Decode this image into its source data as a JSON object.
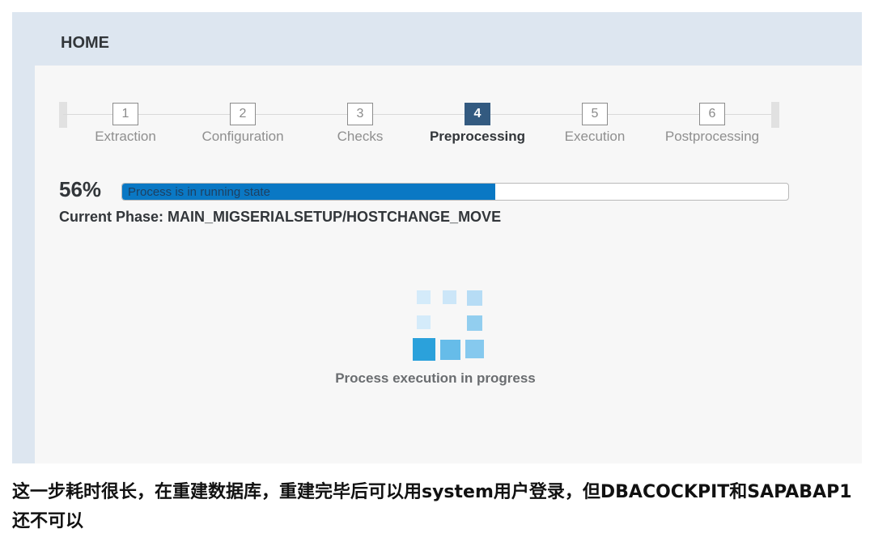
{
  "header": {
    "title": "HOME"
  },
  "wizard": {
    "steps": [
      {
        "number": "1",
        "label": "Extraction",
        "state": "completed"
      },
      {
        "number": "2",
        "label": "Configuration",
        "state": "completed"
      },
      {
        "number": "3",
        "label": "Checks",
        "state": "completed"
      },
      {
        "number": "4",
        "label": "Preprocessing",
        "state": "active"
      },
      {
        "number": "5",
        "label": "Execution",
        "state": "pending"
      },
      {
        "number": "6",
        "label": "Postprocessing",
        "state": "pending"
      }
    ]
  },
  "progress": {
    "percent_label": "56%",
    "value": 0.56,
    "status_text": "Process is in running state",
    "current_phase": "Current Phase: MAIN_MIGSERIALSETUP/HOSTCHANGE_MOVE",
    "fill_color": "#0a78c4"
  },
  "busy_indicator": {
    "icon": "loading-squares-icon",
    "message": "Process execution in progress"
  },
  "caption": {
    "text": "这一步耗时很长，在重建数据库，重建完毕后可以用system用户登录，但DBACOCKPIT和SAPABAP1还不可以"
  },
  "colors": {
    "active_step": "#335a80",
    "frame_background": "#dde6f0",
    "panel_background": "#f7f7f7"
  }
}
